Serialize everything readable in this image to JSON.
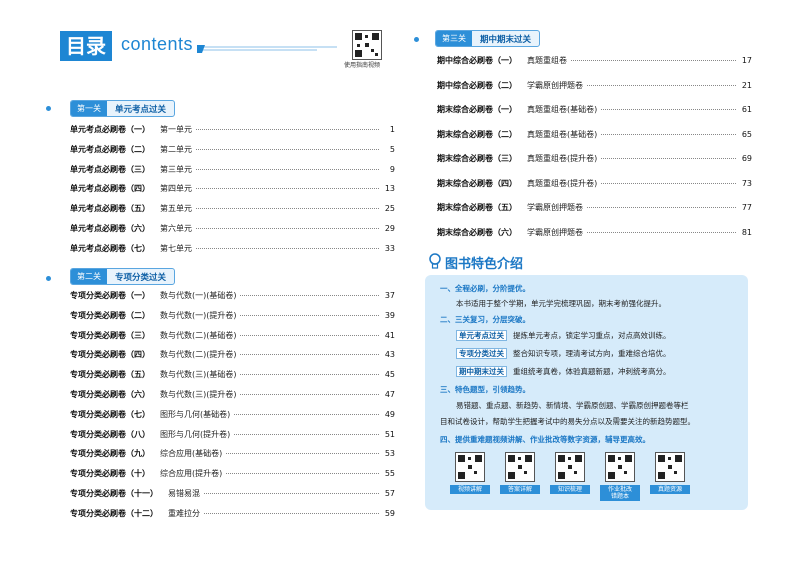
{
  "header": {
    "title_cn": "目录",
    "title_en": "contents",
    "qr_label": "使用指南视频"
  },
  "sections": {
    "s1": {
      "tag": "第一关",
      "title": "单元考点过关"
    },
    "s2": {
      "tag": "第二关",
      "title": "专项分类过关"
    },
    "s3": {
      "tag": "第三关",
      "title": "期中期末过关"
    }
  },
  "toc_s1": [
    {
      "name": "单元考点必刷卷（一）",
      "sub": "第一单元",
      "page": "1"
    },
    {
      "name": "单元考点必刷卷（二）",
      "sub": "第二单元",
      "page": "5"
    },
    {
      "name": "单元考点必刷卷（三）",
      "sub": "第三单元",
      "page": "9"
    },
    {
      "name": "单元考点必刷卷（四）",
      "sub": "第四单元",
      "page": "13"
    },
    {
      "name": "单元考点必刷卷（五）",
      "sub": "第五单元",
      "page": "25"
    },
    {
      "name": "单元考点必刷卷（六）",
      "sub": "第六单元",
      "page": "29"
    },
    {
      "name": "单元考点必刷卷（七）",
      "sub": "第七单元",
      "page": "33"
    }
  ],
  "toc_s2": [
    {
      "name": "专项分类必刷卷（一）",
      "sub": "数与代数(一)(基础卷)",
      "page": "37"
    },
    {
      "name": "专项分类必刷卷（二）",
      "sub": "数与代数(一)(提升卷)",
      "page": "39"
    },
    {
      "name": "专项分类必刷卷（三）",
      "sub": "数与代数(二)(基础卷)",
      "page": "41"
    },
    {
      "name": "专项分类必刷卷（四）",
      "sub": "数与代数(二)(提升卷)",
      "page": "43"
    },
    {
      "name": "专项分类必刷卷（五）",
      "sub": "数与代数(三)(基础卷)",
      "page": "45"
    },
    {
      "name": "专项分类必刷卷（六）",
      "sub": "数与代数(三)(提升卷)",
      "page": "47"
    },
    {
      "name": "专项分类必刷卷（七）",
      "sub": "图形与几何(基础卷)",
      "page": "49"
    },
    {
      "name": "专项分类必刷卷（八）",
      "sub": "图形与几何(提升卷)",
      "page": "51"
    },
    {
      "name": "专项分类必刷卷（九）",
      "sub": "综合应用(基础卷)",
      "page": "53"
    },
    {
      "name": "专项分类必刷卷（十）",
      "sub": "综合应用(提升卷)",
      "page": "55"
    },
    {
      "name": "专项分类必刷卷（十一）",
      "sub": "易错易混",
      "page": "57"
    },
    {
      "name": "专项分类必刷卷（十二）",
      "sub": "重难拉分",
      "page": "59"
    }
  ],
  "toc_s3": [
    {
      "name": "期中综合必刷卷（一）",
      "sub": "真题重组卷",
      "page": "17"
    },
    {
      "name": "期中综合必刷卷（二）",
      "sub": "学霸原创押题卷",
      "page": "21"
    },
    {
      "name": "期末综合必刷卷（一）",
      "sub": "真题重组卷(基础卷)",
      "page": "61"
    },
    {
      "name": "期末综合必刷卷（二）",
      "sub": "真题重组卷(基础卷)",
      "page": "65"
    },
    {
      "name": "期末综合必刷卷（三）",
      "sub": "真题重组卷(提升卷)",
      "page": "69"
    },
    {
      "name": "期末综合必刷卷（四）",
      "sub": "真题重组卷(提升卷)",
      "page": "73"
    },
    {
      "name": "期末综合必刷卷（五）",
      "sub": "学霸原创押题卷",
      "page": "77"
    },
    {
      "name": "期末综合必刷卷（六）",
      "sub": "学霸原创押题卷",
      "page": "81"
    }
  ],
  "features": {
    "title": "图书特色介绍",
    "p1_head": "一、全程必刷，分阶提优。",
    "p1_text": "本书适用于整个学期，单元学完梳理巩固，期末考前强化提升。",
    "p2_head": "二、三关复习，分层突破。",
    "p2_rows": [
      {
        "label": "单元考点过关",
        "text": "提炼单元考点，锁定学习重点，对点高效训练。"
      },
      {
        "label": "专项分类过关",
        "text": "整合知识专项，理清考试方向，重难综合培优。"
      },
      {
        "label": "期中期末过关",
        "text": "重组统考真卷，体验真题新题，冲刺统考高分。"
      }
    ],
    "p3_head": "三、特色题型，引领趋势。",
    "p3_text1": "易错题、重点题、新趋势、新情境、学霸原创题、学霸原创押题卷等栏",
    "p3_text2": "目和试卷设计，帮助学生把握考试中的易失分点以及需要关注的新趋势题型。",
    "p4_head": "四、提供重难题视频讲解、作业批改等数字资源，辅导更高效。",
    "qr_labels": [
      "视频讲解",
      "答案详解",
      "知识梳理",
      "作业批改\n错题本",
      "真题资源"
    ]
  }
}
